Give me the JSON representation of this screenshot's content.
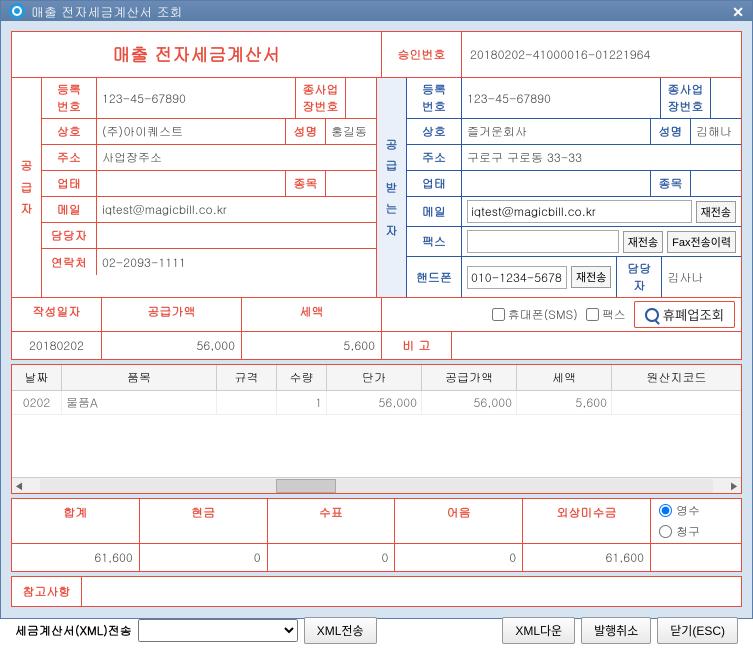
{
  "window": {
    "title": "매출 전자세금계산서 조회"
  },
  "header": {
    "title": "매출 전자세금계산서",
    "approval_label": "승인번호",
    "approval_no": "20180202-41000016-01221964"
  },
  "supplier": {
    "vlabel": "공\n급\n자",
    "regno_lbl": "등록\n번호",
    "regno": "123-45-67890",
    "subbiz_lbl": "종사업\n장번호",
    "subbiz": "",
    "name_lbl": "상호",
    "name": "(주)아이퀘스트",
    "ceo_lbl": "성명",
    "ceo": "홍길동",
    "addr_lbl": "주소",
    "addr": "사업장주소",
    "biztype_lbl": "업태",
    "biztype": "",
    "bizitem_lbl": "종목",
    "bizitem": "",
    "email_lbl": "메일",
    "email": "iqtest@magicbill.co.kr",
    "mgr_lbl": "담당자",
    "mgr": "",
    "contact_lbl": "연락처",
    "contact": "02-2093-1111"
  },
  "buyer": {
    "vlabel": "공\n급\n받\n는\n자",
    "regno_lbl": "등록\n번호",
    "regno": "123-45-67890",
    "subbiz_lbl": "종사업\n장번호",
    "subbiz": "",
    "name_lbl": "상호",
    "name": "즐거운회사",
    "ceo_lbl": "성명",
    "ceo": "김해나",
    "addr_lbl": "주소",
    "addr": "구로구 구로동 33-33",
    "biztype_lbl": "업태",
    "biztype": "",
    "bizitem_lbl": "종목",
    "bizitem": "",
    "email_lbl": "메일",
    "email": "iqtest@magicbill.co.kr",
    "fax_lbl": "팩스",
    "fax": "",
    "mobile_lbl": "핸드폰",
    "mobile": "010-1234-5678",
    "mgr_lbl": "담당자",
    "mgr": "김사나"
  },
  "btns": {
    "resend": "재전송",
    "fax_hist": "Fax전송이력"
  },
  "summary": {
    "date_lbl": "작성일자",
    "supply_lbl": "공급가액",
    "tax_lbl": "세액",
    "date": "20180202",
    "supply": "56,000",
    "tax": "5,600",
    "remark_lbl": "비 고",
    "sms_lbl": "휴대폰(SMS)",
    "fax_lbl": "팩스",
    "lookup_btn": "휴폐업조회"
  },
  "grid": {
    "cols": {
      "date": "날짜",
      "item": "품목",
      "spec": "규격",
      "qty": "수량",
      "price": "단가",
      "supply": "공급가액",
      "tax": "세액",
      "origin": "원산지코드"
    },
    "rows": [
      {
        "date": "0202",
        "item": "물품A",
        "spec": "",
        "qty": "1",
        "price": "56,000",
        "supply": "56,000",
        "tax": "5,600",
        "origin": ""
      }
    ]
  },
  "totals": {
    "sum_lbl": "합계",
    "cash_lbl": "현금",
    "check_lbl": "수표",
    "note_lbl": "어음",
    "credit_lbl": "외상미수금",
    "sum": "61,600",
    "cash": "0",
    "check": "0",
    "note": "0",
    "credit": "61,600",
    "receipt_lbl": "영수",
    "claim_lbl": "청구"
  },
  "note": {
    "lbl": "참고사항",
    "val": ""
  },
  "footer": {
    "xml_lbl": "세금계산서(XML)전송",
    "xml_send": "XML전송",
    "xml_down": "XML다운",
    "cancel": "발행취소",
    "close": "닫기(ESC)"
  }
}
